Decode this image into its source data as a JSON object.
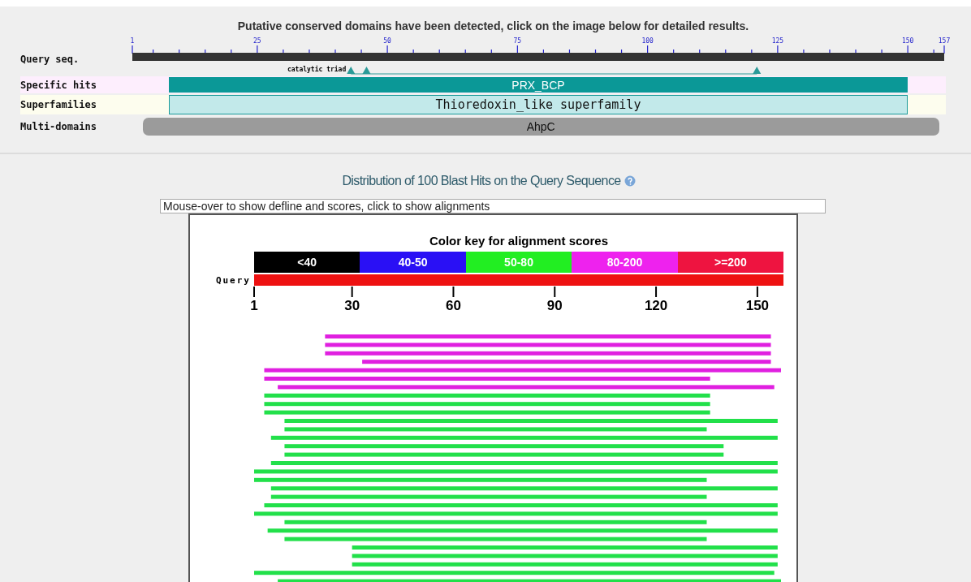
{
  "cdd": {
    "heading": "Putative conserved domains have been detected, click on the image below for detailed results.",
    "ruler_labels": [
      "1",
      "25",
      "50",
      "75",
      "100",
      "125",
      "150",
      "157"
    ],
    "query_label": "Query seq.",
    "feature_label": "catalytic triad",
    "rows": [
      {
        "label": "Specific hits",
        "kind": "specific",
        "domain": "PRX_BCP"
      },
      {
        "label": "Superfamilies",
        "kind": "superfamily",
        "domain": "Thioredoxin_like superfamily"
      },
      {
        "label": "Multi-domains",
        "kind": "multi",
        "domain": "AhpC"
      }
    ]
  },
  "blast": {
    "title": "Distribution of 100 Blast Hits on the Query Sequence",
    "info_field": {
      "value": "Mouse-over to show defline and scores, click to show alignments"
    },
    "key_title": "Color key for alignment scores",
    "key": [
      {
        "label": "<40",
        "color": "#000000"
      },
      {
        "label": "40-50",
        "color": "#2a10f5"
      },
      {
        "label": "50-80",
        "color": "#22ee22"
      },
      {
        "label": "80-200",
        "color": "#ee22ee"
      },
      {
        "label": ">=200",
        "color": "#ee1440"
      }
    ],
    "query_label": "Query",
    "axis_labels": [
      "1",
      "30",
      "60",
      "90",
      "120",
      "150"
    ]
  }
}
